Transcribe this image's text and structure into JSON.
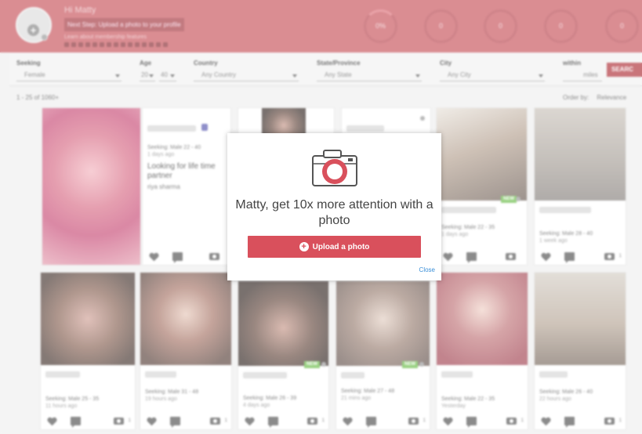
{
  "header": {
    "hello": "Hi Matty",
    "next_step": "Next Step: Upload a photo to your profile",
    "learn_more": "Learn about membership features",
    "stats": [
      "0%",
      "0",
      "0",
      "0",
      "0"
    ],
    "colors": {
      "brand": "#c9575f",
      "accent": "#d9505c"
    }
  },
  "filters": {
    "seeking": {
      "label": "Seeking",
      "value": "Female"
    },
    "age": {
      "label": "Age",
      "min": "20",
      "max": "40"
    },
    "country": {
      "label": "Country",
      "value": "Any Country"
    },
    "state": {
      "label": "State/Province",
      "value": "Any State"
    },
    "city": {
      "label": "City",
      "value": "Any City"
    },
    "within": {
      "label": "within",
      "value": "miles"
    },
    "search_label": "SEARC"
  },
  "results": {
    "count_text": "1 - 25 of 1060+",
    "order_label": "Order by:",
    "order_value": "Relevance"
  },
  "cards": [
    {
      "meta": "",
      "time": ""
    },
    {
      "meta": "Seeking: Male 22 - 40",
      "time": "1 days ago",
      "headline": "Looking for life time partner",
      "tagline": "riya sharma"
    },
    {
      "meta": "",
      "time": ""
    },
    {
      "meta": "",
      "time": ""
    },
    {
      "meta": "Seeking: Male 22 - 35",
      "time": "1 days ago"
    },
    {
      "meta": "Seeking: Male 28 - 40",
      "time": "1 week ago",
      "count": "1"
    },
    {
      "meta": "Seeking: Male 25 - 35",
      "time": "11 hours ago",
      "count": "1"
    },
    {
      "meta": "Seeking: Male 31 - 48",
      "time": "19 hours ago",
      "count": "1"
    },
    {
      "meta": "Seeking: Male 26 - 39",
      "time": "4 days ago",
      "count": "1"
    },
    {
      "meta": "Seeking: Male 27 - 48",
      "time": "21 mins ago",
      "count": "1"
    },
    {
      "meta": "Seeking: Male 22 - 35",
      "time": "Yesterday",
      "count": "1"
    },
    {
      "meta": "Seeking: Male 26 - 40",
      "time": "22 hours ago",
      "count": "1"
    }
  ],
  "badges": {
    "new": "NEW"
  },
  "modal": {
    "title": "Matty, get 10x more attention with a photo",
    "upload_label": "Upload a photo",
    "close_label": "Close",
    "icon": "camera-icon"
  }
}
